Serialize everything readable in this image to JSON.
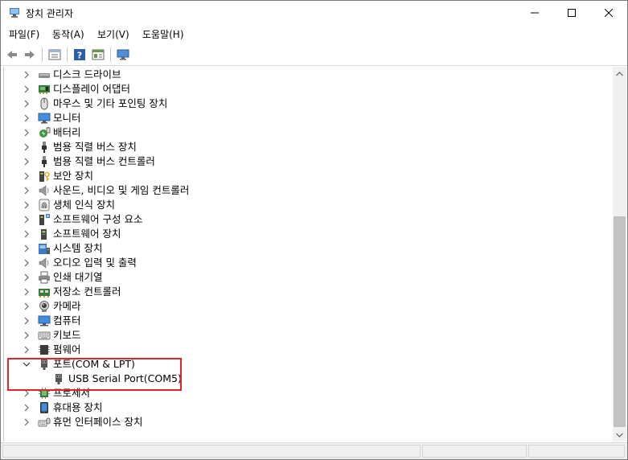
{
  "window": {
    "title": "장치 관리자"
  },
  "menu": [
    {
      "label": "파일(F)"
    },
    {
      "label": "동작(A)"
    },
    {
      "label": "보기(V)"
    },
    {
      "label": "도움말(H)"
    }
  ],
  "toolbar": [
    "back-icon",
    "forward-icon",
    "properties-icon",
    "help-icon",
    "driver-icon",
    "monitor-icon"
  ],
  "tree": {
    "items": [
      {
        "label": "디스크 드라이브",
        "icon": "disk-drive-icon",
        "expanded": false
      },
      {
        "label": "디스플레이 어댑터",
        "icon": "display-adapter-icon",
        "expanded": false
      },
      {
        "label": "마우스 및 기타 포인팅 장치",
        "icon": "mouse-icon",
        "expanded": false
      },
      {
        "label": "모니터",
        "icon": "monitor-icon",
        "expanded": false
      },
      {
        "label": "배터리",
        "icon": "battery-icon",
        "expanded": false
      },
      {
        "label": "범용 직렬 버스 장치",
        "icon": "usb-icon",
        "expanded": false
      },
      {
        "label": "범용 직렬 버스 컨트롤러",
        "icon": "usb-icon",
        "expanded": false
      },
      {
        "label": "보안 장치",
        "icon": "security-key-icon",
        "expanded": false
      },
      {
        "label": "사운드, 비디오 및 게임 컨트롤러",
        "icon": "speaker-icon",
        "expanded": false
      },
      {
        "label": "생체 인식 장치",
        "icon": "fingerprint-icon",
        "expanded": false
      },
      {
        "label": "소프트웨어 구성 요소",
        "icon": "software-component-icon",
        "expanded": false
      },
      {
        "label": "소프트웨어 장치",
        "icon": "software-device-icon",
        "expanded": false
      },
      {
        "label": "시스템 장치",
        "icon": "system-device-icon",
        "expanded": false
      },
      {
        "label": "오디오 입력 및 출력",
        "icon": "speaker-icon",
        "expanded": false
      },
      {
        "label": "인쇄 대기열",
        "icon": "printer-icon",
        "expanded": false
      },
      {
        "label": "저장소 컨트롤러",
        "icon": "storage-controller-icon",
        "expanded": false
      },
      {
        "label": "카메라",
        "icon": "camera-icon",
        "expanded": false
      },
      {
        "label": "컴퓨터",
        "icon": "computer-icon",
        "expanded": false
      },
      {
        "label": "키보드",
        "icon": "keyboard-icon",
        "expanded": false
      },
      {
        "label": "펌웨어",
        "icon": "firmware-icon",
        "expanded": false
      },
      {
        "label": "포트(COM & LPT)",
        "icon": "port-icon",
        "expanded": true
      },
      {
        "label": "USB Serial Port(COM5)",
        "icon": "port-icon",
        "child": true
      },
      {
        "label": "프로세서",
        "icon": "processor-icon",
        "expanded": false
      },
      {
        "label": "휴대용 장치",
        "icon": "portable-device-icon",
        "expanded": false
      },
      {
        "label": "휴먼 인터페이스 장치",
        "icon": "hid-icon",
        "expanded": false
      }
    ]
  },
  "colors": {
    "highlight": "#e0242b",
    "scroll_thumb": "#c2c2c2"
  }
}
